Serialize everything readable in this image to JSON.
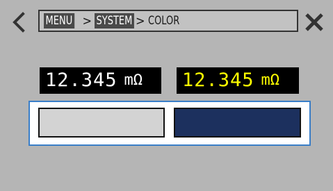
{
  "header": {
    "back_icon": "chevron-left-icon",
    "close_icon": "close-icon",
    "breadcrumb": [
      {
        "label": "MENU",
        "boxed": true
      },
      {
        "label": "SYSTEM",
        "boxed": true
      },
      {
        "label": "COLOR",
        "boxed": false
      }
    ],
    "separator": ">"
  },
  "readings": [
    {
      "value": "12.345",
      "unit": "mΩ",
      "color": "#ffffff"
    },
    {
      "value": "12.345",
      "unit": "mΩ",
      "color": "#ffff00"
    }
  ],
  "colors": {
    "background": "#b5b5b5",
    "selection_border": "#3a7ec8",
    "swatch_light": "#d3d3d3",
    "swatch_dark": "#1c305e"
  }
}
